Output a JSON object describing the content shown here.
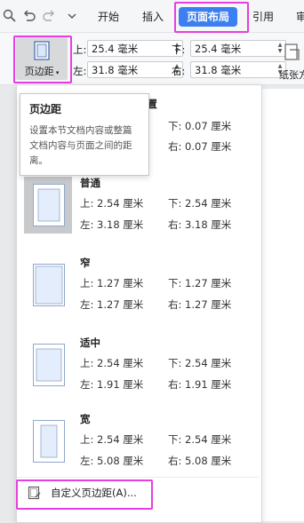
{
  "menubar": {
    "tabs": [
      "开始",
      "插入",
      "页面布局",
      "引用",
      "审"
    ],
    "active_tab": "页面布局",
    "accent_color": "#3c7ff0"
  },
  "ribbon": {
    "margins_button_label": "页边距",
    "top_label": "上:",
    "top_value": "25.4 毫米",
    "bottom_label": "下:",
    "bottom_value": "25.4 毫米",
    "left_label": "左:",
    "left_value": "31.8 毫米",
    "right_label": "右:",
    "right_value": "31.8 毫米",
    "orientation_label": "纸张方"
  },
  "ruler": {
    "number": "4"
  },
  "tooltip": {
    "title": "页边距",
    "body": "设置本节文档内容或整篇文档内容与页面之间的距离。"
  },
  "dropdown": {
    "last_setting": {
      "name_fragment": "设置",
      "bottom": "下: 0.07 厘米",
      "right": "右: 0.07 厘米"
    },
    "presets": [
      {
        "name": "普通",
        "top": "上: 2.54 厘米",
        "bottom": "下: 2.54 厘米",
        "left": "左: 3.18 厘米",
        "right": "右: 3.18 厘米",
        "selected": true
      },
      {
        "name": "窄",
        "top": "上: 1.27 厘米",
        "bottom": "下: 1.27 厘米",
        "left": "左: 1.27 厘米",
        "right": "右: 1.27 厘米",
        "selected": false
      },
      {
        "name": "适中",
        "top": "上: 2.54 厘米",
        "bottom": "下: 2.54 厘米",
        "left": "左: 1.91 厘米",
        "right": "右: 1.91 厘米",
        "selected": false
      },
      {
        "name": "宽",
        "top": "上: 2.54 厘米",
        "bottom": "下: 2.54 厘米",
        "left": "左: 5.08 厘米",
        "right": "右: 5.08 厘米",
        "selected": false
      }
    ],
    "custom_label": "自定义页边距(A)...",
    "highlight_color": "#e63ee0"
  }
}
